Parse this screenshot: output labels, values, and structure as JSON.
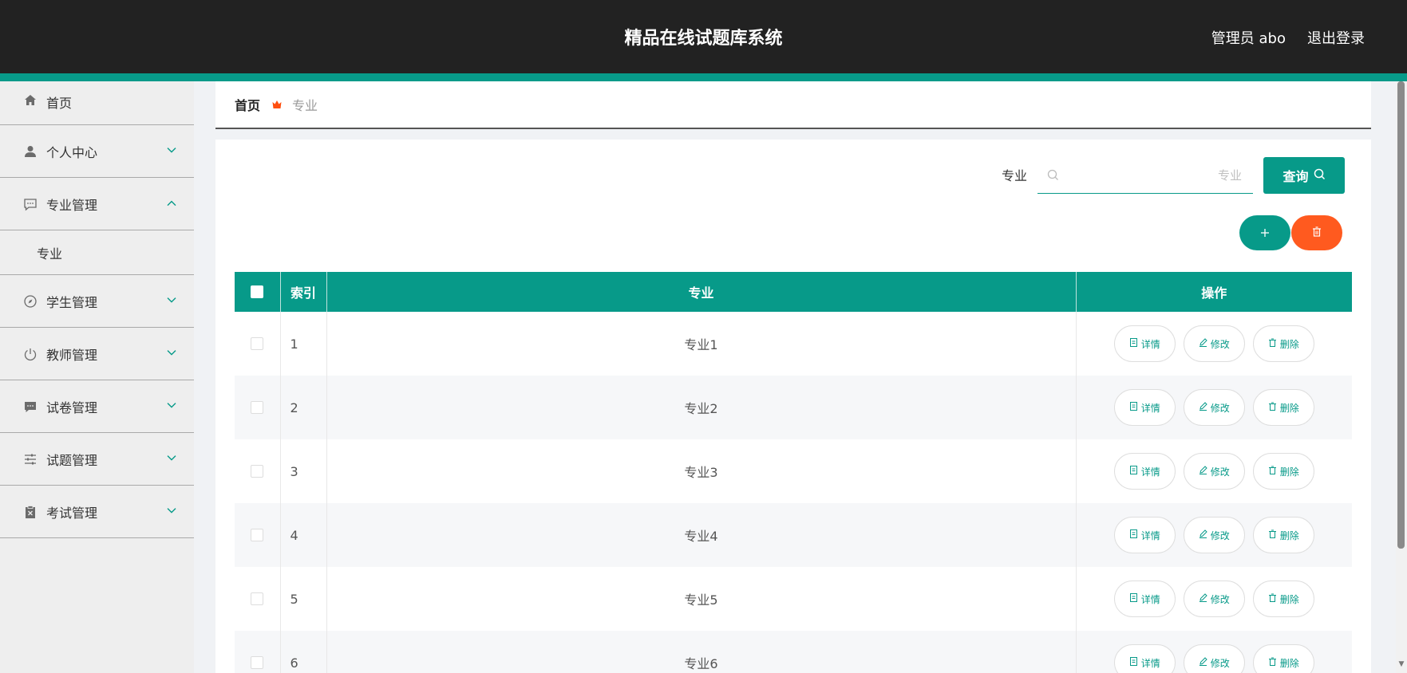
{
  "header": {
    "title": "精品在线试题库系统",
    "user": "管理员 abo",
    "logout": "退出登录"
  },
  "sidebar": {
    "items": [
      {
        "label": "首页",
        "icon": "home-icon"
      },
      {
        "label": "个人中心",
        "icon": "user-icon",
        "expanded": false
      },
      {
        "label": "专业管理",
        "icon": "chat-icon",
        "expanded": true,
        "children": [
          "专业"
        ]
      },
      {
        "label": "学生管理",
        "icon": "compass-icon",
        "expanded": false
      },
      {
        "label": "教师管理",
        "icon": "power-icon",
        "expanded": false
      },
      {
        "label": "试卷管理",
        "icon": "message-icon",
        "expanded": false
      },
      {
        "label": "试题管理",
        "icon": "sliders-icon",
        "expanded": false
      },
      {
        "label": "考试管理",
        "icon": "clipboard-icon",
        "expanded": false
      }
    ]
  },
  "breadcrumb": {
    "home": "首页",
    "current": "专业"
  },
  "search": {
    "label": "专业",
    "placeholder": "专业",
    "button": "查询"
  },
  "table": {
    "headers": {
      "index": "索引",
      "name": "专业",
      "actions": "操作"
    },
    "rows": [
      {
        "index": "1",
        "name": "专业1"
      },
      {
        "index": "2",
        "name": "专业2"
      },
      {
        "index": "3",
        "name": "专业3"
      },
      {
        "index": "4",
        "name": "专业4"
      },
      {
        "index": "5",
        "name": "专业5"
      },
      {
        "index": "6",
        "name": "专业6"
      }
    ],
    "actions": {
      "detail": "详情",
      "edit": "修改",
      "delete": "删除"
    }
  },
  "colors": {
    "accent": "#079a89",
    "danger": "#ff5a1f",
    "header_bg": "#222222"
  }
}
